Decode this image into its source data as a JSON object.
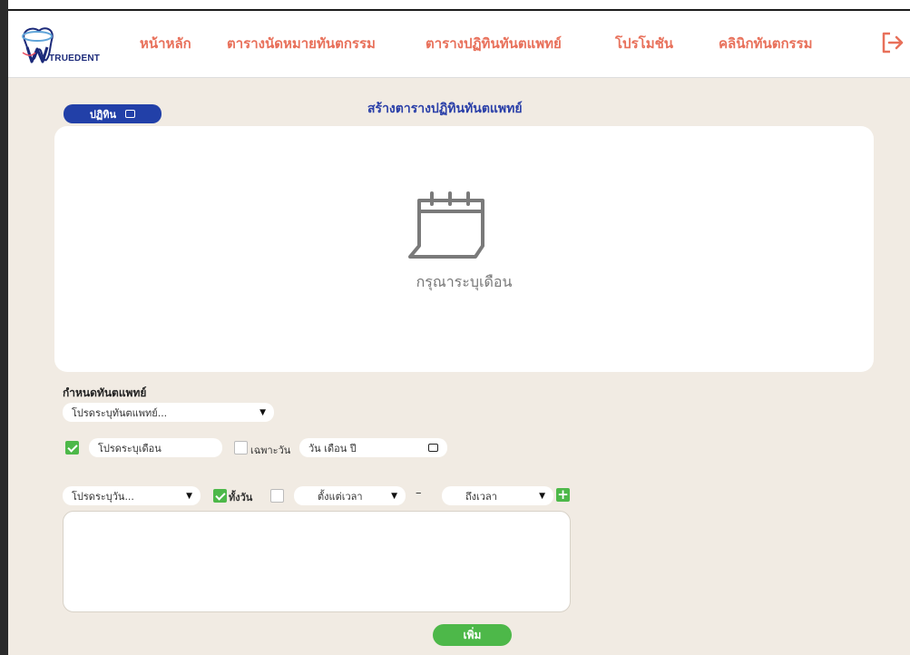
{
  "app": {
    "logo_text": "TRUEDENT"
  },
  "nav": {
    "items": [
      {
        "label": "หน้าหลัก"
      },
      {
        "label": "ตารางนัดหมายทันตกรรม"
      },
      {
        "label": "ตารางปฏิทินทันตแพทย์"
      },
      {
        "label": "โปรโมชัน"
      },
      {
        "label": "คลินิกทันตกรรม"
      }
    ]
  },
  "toolbar": {
    "work_label": "ปฏิทิน"
  },
  "page": {
    "title": "สร้างตารางปฏิทินทันตแพทย์"
  },
  "calendar": {
    "empty_text": "กรุณาระบุเดือน"
  },
  "form": {
    "doctor_section_label": "กำหนดทันตแพทย์",
    "doctor_select_value": "โปรดระบุทันตแพทย์...",
    "month_checked": true,
    "month_placeholder": "โปรดระบุเดือน",
    "specific_day_checked": false,
    "specific_day_label": "เฉพาะวัน",
    "date_placeholder": "วัน เดือน ปี",
    "day_select_value": "โปรดระบุวัน...",
    "all_day_checked": true,
    "all_day_label": "ทั้งวัน",
    "time_checked": false,
    "start_time_value": "ตั้งแต่เวลา",
    "dash": "–",
    "end_time_value": "ถึงเวลา",
    "add_label": "+",
    "submit_label": "เพิ่ม"
  },
  "colors": {
    "accent_nav": "#e8705a",
    "primary_blue": "#2240a8",
    "success_green": "#4db849",
    "background": "#f1ebe3"
  }
}
